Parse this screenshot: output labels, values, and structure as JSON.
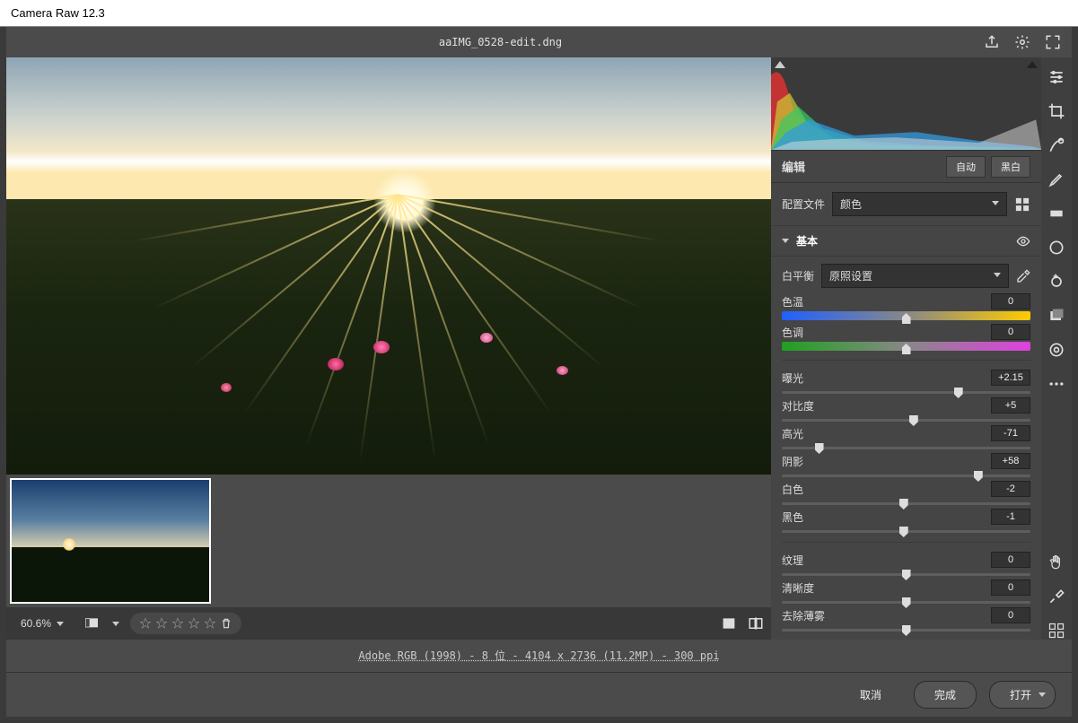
{
  "app": {
    "title": "Camera Raw 12.3"
  },
  "file": {
    "name": "aaIMG_0528-edit.dng"
  },
  "zoom": {
    "value": "60.6%"
  },
  "info_line": "Adobe RGB (1998) - 8 位 - 4104 x 2736 (11.2MP) - 300 ppi",
  "actions": {
    "cancel": "取消",
    "done": "完成",
    "open": "打开"
  },
  "edit": {
    "header": "编辑",
    "auto": "自动",
    "bw": "黑白",
    "profile_label": "配置文件",
    "profile_value": "颜色"
  },
  "basic": {
    "title": "基本",
    "wb_label": "白平衡",
    "wb_value": "原照设置",
    "sliders_a": [
      {
        "name": "色温",
        "value": "0",
        "pos": 50,
        "gradient": "linear-gradient(to right,#2060ff,#888,#ffcc00)"
      },
      {
        "name": "色调",
        "value": "0",
        "pos": 50,
        "gradient": "linear-gradient(to right,#20a020,#888,#e040e0)"
      }
    ],
    "sliders_b": [
      {
        "name": "曝光",
        "value": "+2.15",
        "pos": 71
      },
      {
        "name": "对比度",
        "value": "+5",
        "pos": 53
      },
      {
        "name": "高光",
        "value": "-71",
        "pos": 15
      },
      {
        "name": "阴影",
        "value": "+58",
        "pos": 79
      },
      {
        "name": "白色",
        "value": "-2",
        "pos": 49
      },
      {
        "name": "黑色",
        "value": "-1",
        "pos": 49
      }
    ],
    "sliders_c": [
      {
        "name": "纹理",
        "value": "0",
        "pos": 50
      },
      {
        "name": "清晰度",
        "value": "0",
        "pos": 50
      },
      {
        "name": "去除薄雾",
        "value": "0",
        "pos": 50
      }
    ]
  }
}
